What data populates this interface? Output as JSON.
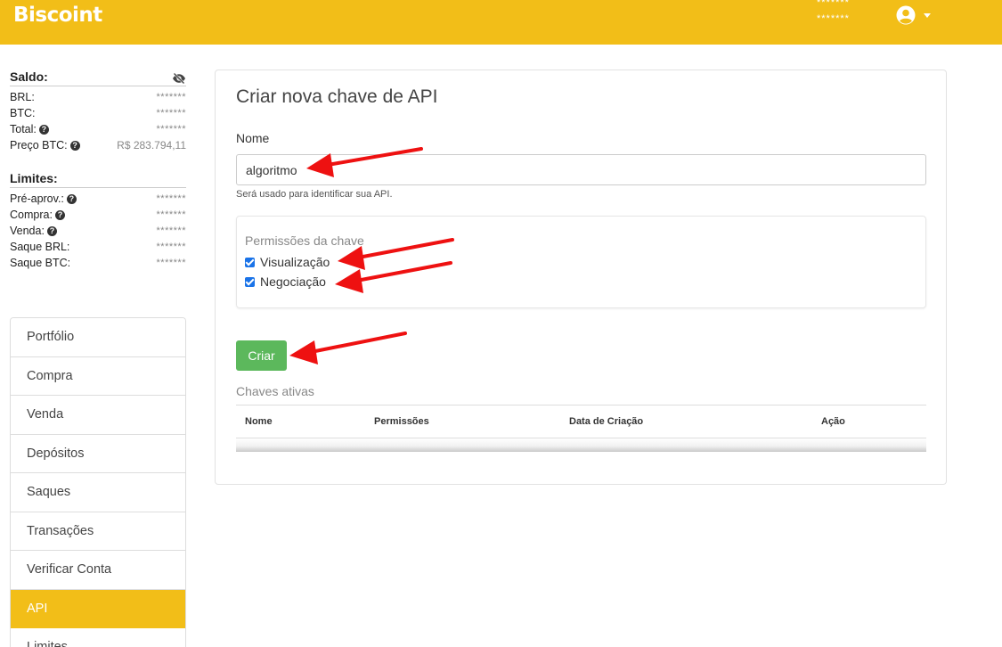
{
  "header": {
    "logo": "Biscoint",
    "masked_line1": "*******",
    "masked_line2": "*******",
    "user_icon": "user-circle-icon"
  },
  "balances": {
    "title": "Saldo:",
    "eye_icon": "eye-slash-icon",
    "rows": [
      {
        "label": "BRL:",
        "value": "*******"
      },
      {
        "label": "BTC:",
        "value": "*******"
      },
      {
        "label": "Total:",
        "value": "*******"
      },
      {
        "label": "Preço BTC:",
        "value": "R$ 283.794,11"
      }
    ]
  },
  "limits": {
    "title": "Limites:",
    "rows": [
      {
        "label": "Pré-aprov.:",
        "value": "*******"
      },
      {
        "label": "Compra:",
        "value": "*******"
      },
      {
        "label": "Venda:",
        "value": "*******"
      },
      {
        "label": "Saque BRL:",
        "value": "*******"
      },
      {
        "label": "Saque BTC:",
        "value": "*******"
      }
    ]
  },
  "menu": {
    "items": [
      "Portfólio",
      "Compra",
      "Venda",
      "Depósitos",
      "Saques",
      "Transações",
      "Verificar Conta",
      "API",
      "Limites"
    ],
    "active": "API"
  },
  "form": {
    "title": "Criar nova chave de API",
    "name_label": "Nome",
    "name_value": "algoritmo",
    "name_help": "Será usado para identificar sua API.",
    "permissions_title": "Permissões da chave",
    "permissions": [
      {
        "label": "Visualização",
        "checked": true
      },
      {
        "label": "Negociação",
        "checked": true
      }
    ],
    "create_button": "Criar"
  },
  "keys": {
    "title": "Chaves ativas",
    "columns": [
      "Nome",
      "Permissões",
      "Data de Criação",
      "Ação"
    ]
  },
  "colors": {
    "brand": "#f2be18",
    "success": "#5cb85c",
    "annotation": "#ee1111"
  }
}
